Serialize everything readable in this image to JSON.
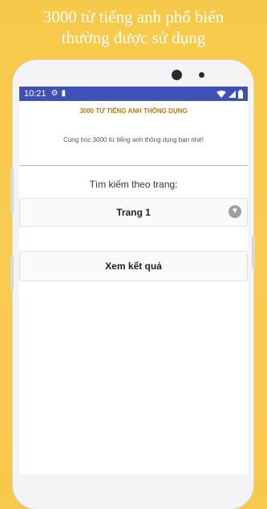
{
  "headline": {
    "line1": "3000 từ tiếng anh phổ biến",
    "line2": "thường được sử dụng"
  },
  "status_bar": {
    "time": "10:21",
    "icons": [
      "gear-icon",
      "sd-card-icon",
      "wifi-icon",
      "signal-icon",
      "battery-icon"
    ]
  },
  "app": {
    "title": "3000 TỪ TIẾNG ANH THÔNG DỤNG",
    "subtitle": "Cùng học 3000 từ tiếng anh thông dụng bạn nhé!",
    "search_label": "Tìm kiếm theo trang:",
    "page_select": {
      "selected": "Trang 1"
    },
    "view_results_label": "Xem kết quả"
  },
  "colors": {
    "status_bar": "#3f51b5",
    "title": "#b07a10",
    "background": "#f8cc51"
  }
}
